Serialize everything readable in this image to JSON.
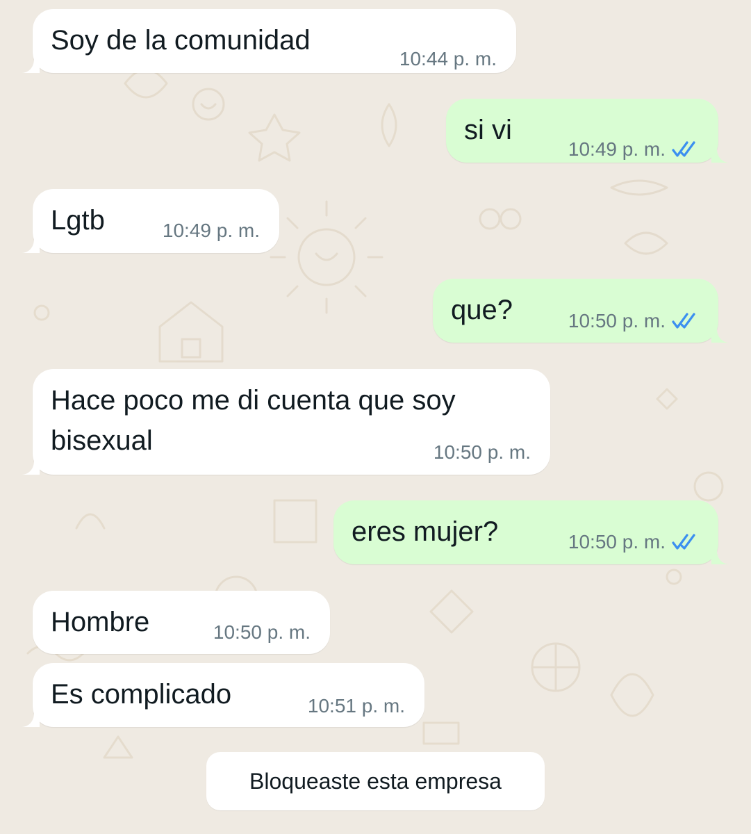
{
  "messages": [
    {
      "direction": "in",
      "text": "Soy de la comunidad",
      "time": "10:44 p. m."
    },
    {
      "direction": "out",
      "text": "si vi",
      "time": "10:49 p. m.",
      "status_icon": "double-check-read-icon"
    },
    {
      "direction": "in",
      "text": "Lgtb",
      "time": "10:49 p. m."
    },
    {
      "direction": "out",
      "text": "que?",
      "time": "10:50 p. m.",
      "status_icon": "double-check-read-icon"
    },
    {
      "direction": "in",
      "text_line1": "Hace poco me di cuenta que soy",
      "text_line2": "bisexual",
      "time": "10:50 p. m."
    },
    {
      "direction": "out",
      "text": "eres mujer?",
      "time": "10:50 p. m.",
      "status_icon": "double-check-read-icon"
    },
    {
      "direction": "in",
      "text": "Hombre",
      "time": "10:50 p. m."
    },
    {
      "direction": "in",
      "text": "Es complicado",
      "time": "10:51 p. m."
    }
  ],
  "system": {
    "blocked_notice": "Bloqueaste esta empresa"
  },
  "colors": {
    "chat_background": "#efeae2",
    "incoming_bubble": "#ffffff",
    "outgoing_bubble": "#d9fdd3",
    "read_ticks": "#3b8ff0",
    "meta_text": "#667781"
  }
}
